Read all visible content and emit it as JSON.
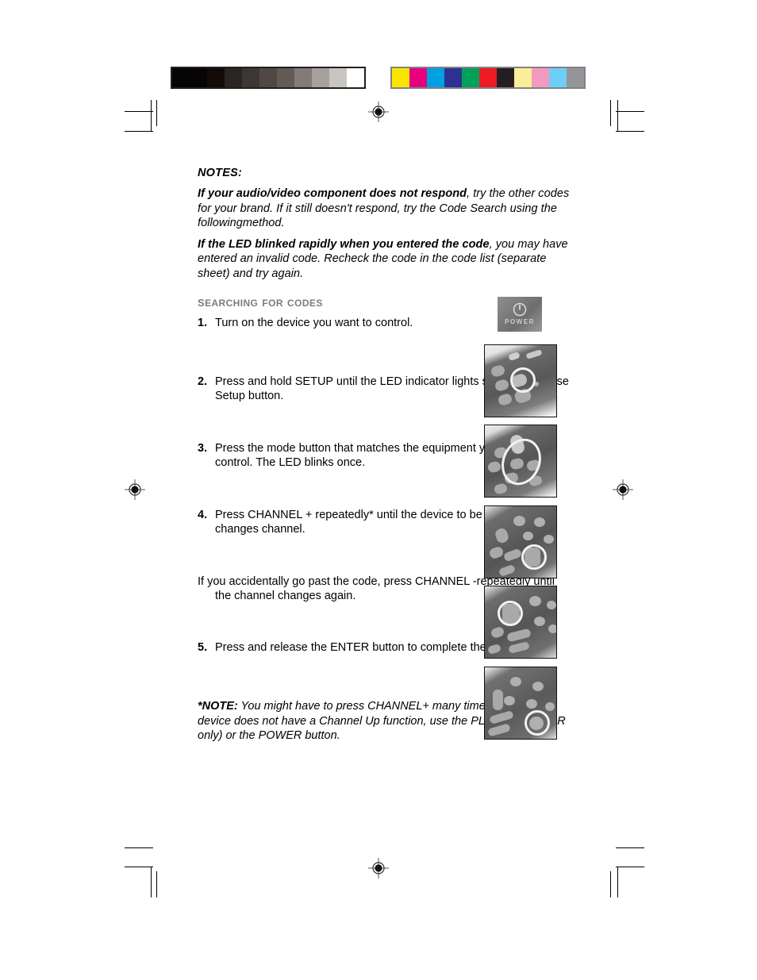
{
  "prepress": {
    "grayscale_patches": [
      "#050505",
      "#070404",
      "#140b09",
      "#2a2523",
      "#3c3734",
      "#4f4845",
      "#645b57",
      "#837b77",
      "#a6a19d",
      "#c9c5c0",
      "#ffffff"
    ],
    "color_patches": [
      "#fbe500",
      "#e6007e",
      "#00a0e3",
      "#2e3191",
      "#00a25b",
      "#ed1c24",
      "#231f20",
      "#fbee99",
      "#f49ac1",
      "#6dcff6",
      "#939598"
    ],
    "gray_strip_border": "#231f20",
    "color_strip_border": "#808285",
    "registration_mark": "registration-target"
  },
  "notes": {
    "heading": "NOTES:",
    "paragraphs": [
      {
        "lead": "If your audio/video component does not respond",
        "rest": ", try the other codes for your brand. If it still doesn't respond, try the Code Search using the followingmethod."
      },
      {
        "lead": "If the LED blinked rapidly when you entered the code",
        "rest": ", you may have entered an invalid code. Recheck the code in the code list (separate sheet) and try again."
      }
    ]
  },
  "section": {
    "heading": "Searching For Codes"
  },
  "steps": [
    {
      "num": "1.",
      "text": "Turn on the device you want to control."
    },
    {
      "num": "2.",
      "text": "Press and hold SETUP until the LED indicator lights steadily. Release Setup button."
    },
    {
      "num": "3.",
      "text": "Press the mode button that matches the equipment you want to control. The LED blinks once."
    },
    {
      "num": "4.",
      "text": "Press CHANNEL + repeatedly* until the device to be controlled changes channel."
    },
    {
      "num": "",
      "text": "If you accidentally go past the code,  press CHANNEL -repeatedly until the channel changes again."
    },
    {
      "num": "5.",
      "text": "Press and release the ENTER button to complete the setup."
    }
  ],
  "footnote": {
    "lead": "*NOTE:",
    "rest": " You might have to press CHANNEL+ many times (50+). If the device does not have a Channel Up function, use the PLAY button (VCR only) or the POWER button."
  },
  "photos": [
    {
      "caption_ref": "1",
      "alt": "remote-power-button-closeup",
      "label": "POWER"
    },
    {
      "caption_ref": "2",
      "alt": "remote-setup-button-highlighted"
    },
    {
      "caption_ref": "3",
      "alt": "remote-mode-buttons-highlighted"
    },
    {
      "caption_ref": "4",
      "alt": "remote-channel-up-button-highlighted"
    },
    {
      "caption_ref": "4b",
      "alt": "remote-channel-down-button-highlighted"
    },
    {
      "caption_ref": "5",
      "alt": "remote-enter-button-highlighted"
    }
  ]
}
